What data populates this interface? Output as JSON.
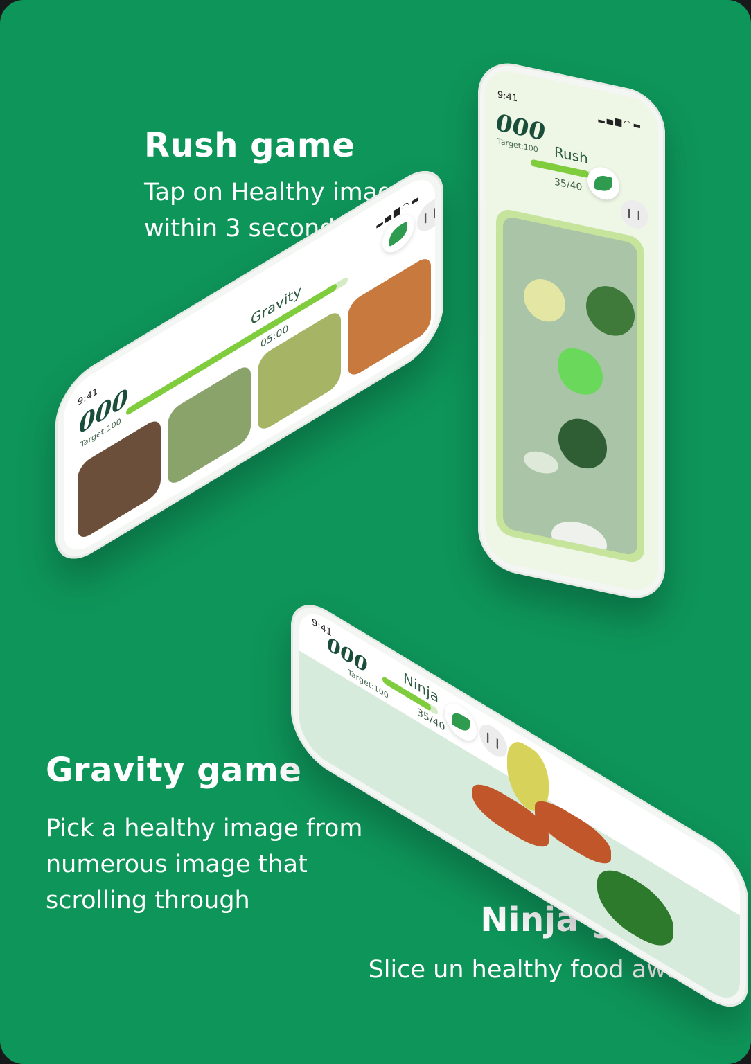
{
  "captions": {
    "rush": {
      "title": "Rush game",
      "desc_line1": "Tap on Healthy image",
      "desc_line2": "within 3 second"
    },
    "gravity": {
      "title": "Gravity game",
      "desc_line1": "Pick a healthy image from",
      "desc_line2": "numerous image that",
      "desc_line3": "scrolling through"
    },
    "ninja": {
      "title": "Ninja game",
      "desc_line1": "Slice un healthy food away"
    }
  },
  "rush_phone": {
    "time": "9:41",
    "score": "000",
    "target": "Target:100",
    "title": "Rush",
    "counter": "35/40",
    "progress": 0.875
  },
  "gravity_phone": {
    "time": "9:41",
    "score": "000",
    "target": "Target:100",
    "title": "Gravity",
    "timer": "05:00",
    "progress": 0.95
  },
  "ninja_phone": {
    "time": "9:41",
    "score": "000",
    "target": "Target:100",
    "title": "Ninja",
    "counter": "35/40",
    "progress": 0.875
  },
  "colors": {
    "background": "#0e955a",
    "accent": "#7fcc3c",
    "text_dark": "#1a4d3a"
  },
  "icons": [
    "leaf-logo-icon",
    "pause-icon",
    "signal-icon",
    "wifi-icon",
    "battery-icon",
    "smiley-logo-icon"
  ]
}
